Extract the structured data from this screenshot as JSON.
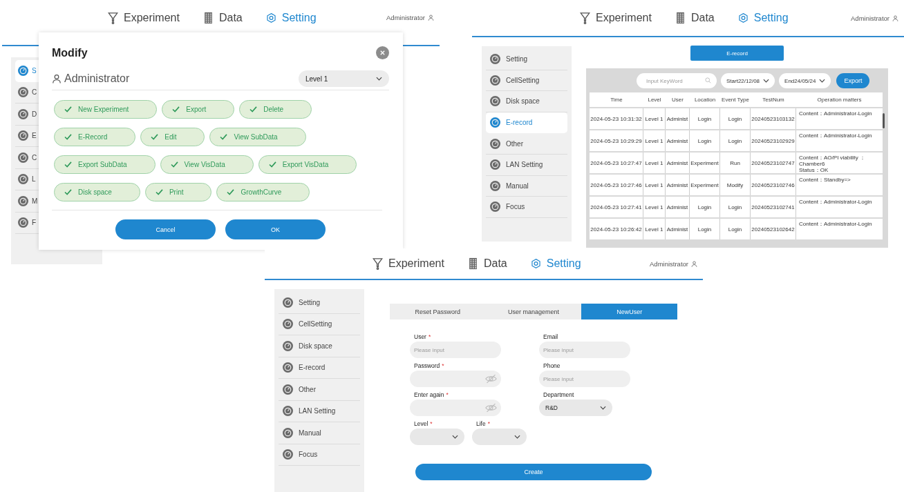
{
  "screens": [
    {
      "kind": "modify",
      "nav": [
        {
          "label": "Experiment",
          "selected": false
        },
        {
          "label": "Data",
          "selected": false
        },
        {
          "label": "Setting",
          "selected": true
        }
      ],
      "user": "Administrator",
      "sidebar": [
        {
          "label": "S",
          "selected": true
        },
        {
          "label": "C",
          "selected": false
        },
        {
          "label": "D",
          "selected": false
        },
        {
          "label": "E",
          "selected": false
        },
        {
          "label": "C",
          "selected": false
        },
        {
          "label": "L",
          "selected": false
        },
        {
          "label": "M",
          "selected": false
        },
        {
          "label": "F",
          "selected": false
        }
      ],
      "dialog": {
        "title": "Modify",
        "user": "Administrator",
        "level_select": "Level 1",
        "permissions": [
          {
            "label": "New Experiment",
            "checked": true
          },
          {
            "label": "Export",
            "checked": true
          },
          {
            "label": "Delete",
            "checked": true
          },
          {
            "label": "E-Record",
            "checked": true
          },
          {
            "label": "Edit",
            "checked": true
          },
          {
            "label": "View SubData",
            "checked": true
          },
          {
            "label": "Export SubData",
            "checked": true
          },
          {
            "label": "View VisData",
            "checked": true
          },
          {
            "label": "Export VisData",
            "checked": true
          },
          {
            "label": "Disk space",
            "checked": true
          },
          {
            "label": "Print",
            "checked": true
          },
          {
            "label": "GrowthCurve",
            "checked": true
          }
        ],
        "buttons": [
          "Cancel",
          "OK"
        ]
      }
    },
    {
      "kind": "erecord",
      "nav": [
        {
          "label": "Experiment",
          "selected": false
        },
        {
          "label": "Data",
          "selected": false
        },
        {
          "label": "Setting",
          "selected": true
        }
      ],
      "user": "Administrator",
      "sidebar": [
        {
          "label": "Setting",
          "selected": false
        },
        {
          "label": "CellSetting",
          "selected": false
        },
        {
          "label": "Disk space",
          "selected": false
        },
        {
          "label": "E-record",
          "selected": true
        },
        {
          "label": "Other",
          "selected": false
        },
        {
          "label": "LAN Setting",
          "selected": false
        },
        {
          "label": "Manual",
          "selected": false
        },
        {
          "label": "Focus",
          "selected": false
        }
      ],
      "heading": "E-record",
      "search": {
        "placeholder": "Input KeyWord"
      },
      "start": "Start22/12/08",
      "end": "End24/05/24",
      "export": "Export",
      "table": {
        "columns": [
          "Time",
          "Level",
          "User",
          "Location",
          "Event Type",
          "TestNum",
          "Operation matters"
        ],
        "rows": [
          [
            "2024-05-23 10:31:32",
            "Level 1",
            "Administ",
            "Login",
            "Login",
            "20240523103132",
            "Content：Administrator-Login"
          ],
          [
            "2024-05-23 10:29:29",
            "Level 1",
            "Administ",
            "Login",
            "Login",
            "20240523102929",
            "Content：Administrator-Login"
          ],
          [
            "2024-05-23 10:27:47",
            "Level 1",
            "Administ",
            "Experiment",
            "Run",
            "20240523102747",
            "Content：AO/PI viability ：Chamber6\nStatus：OK"
          ],
          [
            "2024-05-23 10:27:46",
            "Level 1",
            "Administ",
            "Experiment",
            "Modify",
            "20240523102746",
            "Content：Standby=>"
          ],
          [
            "2024-05-23 10:27:41",
            "Level 1",
            "Administ",
            "Login",
            "Login",
            "20240523102741",
            "Content：Administrator-Login"
          ],
          [
            "2024-05-23 10:26:42",
            "Level 1",
            "Administ",
            "Login",
            "Login",
            "20240523102642",
            "Content：Administrator-Login"
          ]
        ]
      }
    },
    {
      "kind": "new_user",
      "nav": [
        {
          "label": "Experiment",
          "selected": false
        },
        {
          "label": "Data",
          "selected": false
        },
        {
          "label": "Setting",
          "selected": true
        }
      ],
      "user": "Administrator",
      "sidebar": [
        {
          "label": "Setting",
          "selected": false
        },
        {
          "label": "CellSetting",
          "selected": false
        },
        {
          "label": "Disk space",
          "selected": false
        },
        {
          "label": "E-record",
          "selected": false
        },
        {
          "label": "Other",
          "selected": false
        },
        {
          "label": "LAN Setting",
          "selected": false
        },
        {
          "label": "Manual",
          "selected": false
        },
        {
          "label": "Focus",
          "selected": false
        }
      ],
      "tabs": [
        {
          "label": "Reset Password",
          "selected": false
        },
        {
          "label": "User management",
          "selected": false
        },
        {
          "label": "NewUser",
          "selected": true
        }
      ],
      "fields": [
        {
          "label": "User",
          "mark": "*",
          "kind": "text",
          "placeholder": "Please input"
        },
        {
          "label": "Email",
          "kind": "text",
          "placeholder": "Please input"
        },
        {
          "label": "Password",
          "mark": "*",
          "kind": "password"
        },
        {
          "label": "Phone",
          "kind": "text",
          "placeholder": "Please input"
        },
        {
          "label": "Enter again",
          "mark": "*",
          "kind": "password"
        },
        {
          "label": "Department",
          "kind": "select",
          "value": "R&D"
        },
        {
          "label": "Level",
          "mark": "*",
          "kind": "small_select"
        },
        {
          "label": "Life",
          "mark": "*",
          "kind": "small_select"
        }
      ],
      "create": "Create"
    }
  ]
}
